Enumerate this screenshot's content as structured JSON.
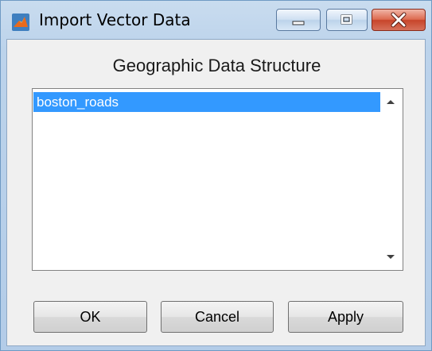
{
  "window": {
    "title": "Import Vector Data",
    "icon": "matlab-icon"
  },
  "caption_buttons": {
    "minimize_icon": "minimize-icon",
    "maximize_icon": "maximize-icon",
    "close_icon": "close-icon"
  },
  "dialog": {
    "heading": "Geographic Data Structure",
    "list": {
      "items": [
        {
          "label": "boston_roads",
          "selected": true
        }
      ]
    },
    "buttons": {
      "ok": "OK",
      "cancel": "Cancel",
      "apply": "Apply"
    }
  },
  "colors": {
    "selection": "#3399ff",
    "close_button": "#c7452a",
    "frame": "#b3cce8"
  }
}
